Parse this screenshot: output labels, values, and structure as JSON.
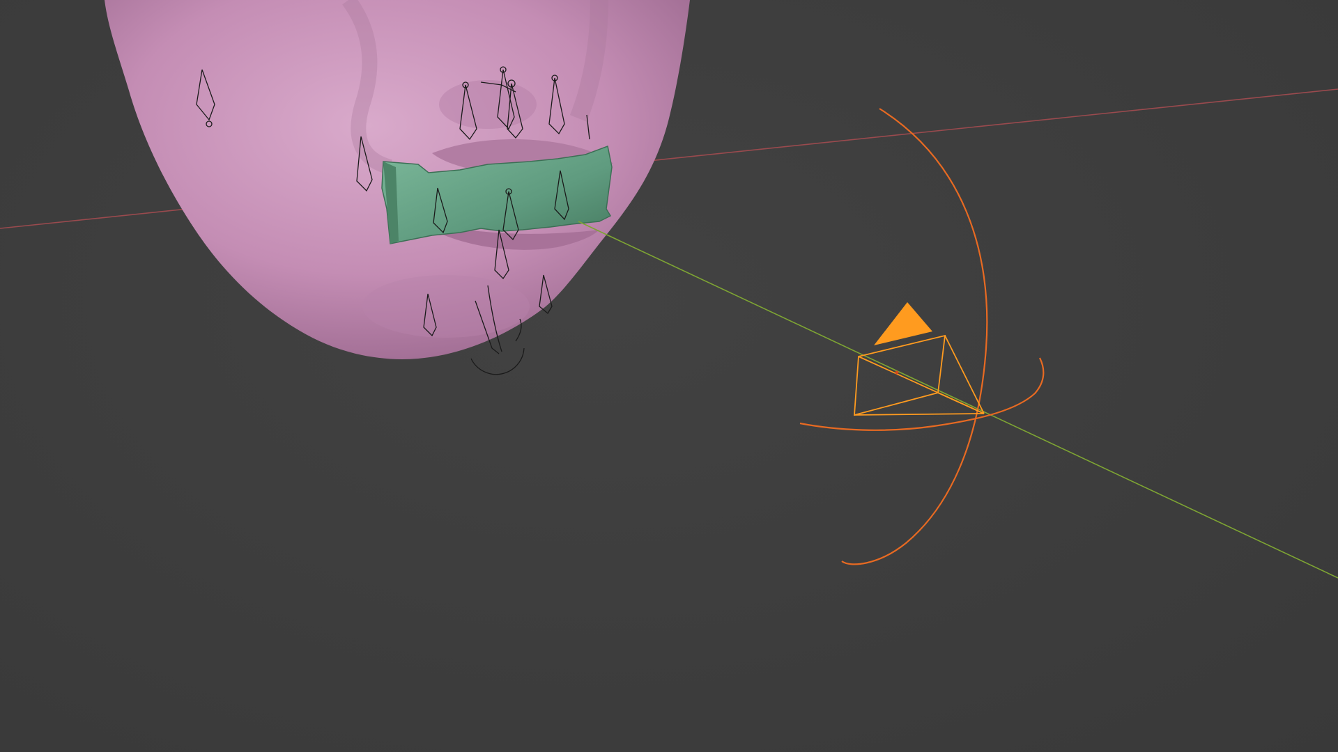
{
  "viewport": {
    "editor": "3D Viewport",
    "objects": [
      {
        "id": "face-mesh",
        "type": "mesh",
        "color": "#c892b8",
        "shade_light": "#d6a6c9",
        "shade_dark": "#9c6a8e"
      },
      {
        "id": "mouth-block-mesh",
        "type": "mesh",
        "color": "#5e9a7e",
        "shade_light": "#79b597",
        "shade_dark": "#3f7358"
      },
      {
        "id": "camera",
        "type": "camera",
        "selected": true,
        "color": "#ff9b1f"
      },
      {
        "id": "armature-bones",
        "type": "armature",
        "color": "#161616"
      }
    ],
    "axes": {
      "x_axis_color": "#a04a4f",
      "y_axis_color": "#7ea533"
    },
    "gizmo": {
      "rotate_ring_color": "#e86a22"
    },
    "background_color": "#3c3c3c"
  }
}
